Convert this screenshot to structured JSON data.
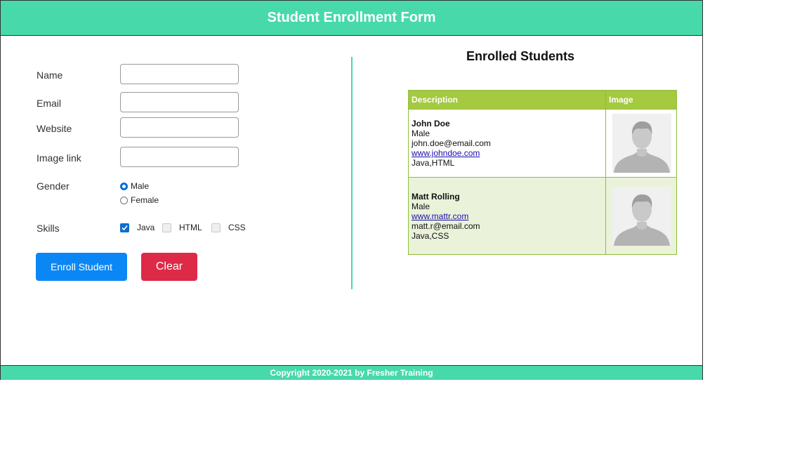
{
  "header": {
    "title": "Student Enrollment Form"
  },
  "form": {
    "name_label": "Name",
    "email_label": "Email",
    "website_label": "Website",
    "image_label": "Image link",
    "gender_label": "Gender",
    "gender_options": [
      "Male",
      "Female"
    ],
    "gender_selected": "Male",
    "skills_label": "Skills",
    "skills": [
      {
        "label": "Java",
        "checked": true
      },
      {
        "label": "HTML",
        "checked": false
      },
      {
        "label": "CSS",
        "checked": false
      }
    ],
    "values": {
      "name": "",
      "email": "",
      "website": "",
      "image": ""
    },
    "enroll_label": "Enroll Student",
    "clear_label": "Clear"
  },
  "enrolled": {
    "title": "Enrolled Students",
    "columns": [
      "Description",
      "Image"
    ],
    "students": [
      {
        "name": "John Doe",
        "gender": "Male",
        "line3": "john.doe@email.com",
        "line4": "www.johndoe.com",
        "skills": "Java,HTML"
      },
      {
        "name": "Matt Rolling",
        "gender": "Male",
        "line3": "www.mattr.com",
        "line4": "matt.r@email.com",
        "skills": "Java,CSS"
      }
    ]
  },
  "footer": {
    "text": "Copyright 2020-2021 by Fresher Training"
  },
  "colors": {
    "accent": "#48d9ab",
    "enroll": "#0b87f5",
    "clear": "#dc2a47",
    "table_header": "#a5c93f",
    "table_alt": "#eaf2d9"
  }
}
